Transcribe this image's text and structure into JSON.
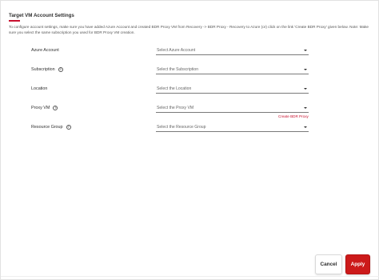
{
  "dialog": {
    "title": "Target VM Account Settings",
    "description": "To configure account settings, make sure you have added Azure Account and created BDR Proxy VM from Recovery -> BDR Proxy - Recovery to Azure (or) click on the link 'Create BDR Proxy' given below. Note: Make sure you select the same subscription you used for BDR Proxy VM creation."
  },
  "fields": [
    {
      "label": "Azure Account",
      "help": false,
      "placeholder": "Select Azure Account"
    },
    {
      "label": "Subscription",
      "help": true,
      "placeholder": "Select the Subscription"
    },
    {
      "label": "Location",
      "help": false,
      "placeholder": "Select the Location"
    },
    {
      "label": "Proxy VM",
      "help": true,
      "placeholder": "Select the Proxy VM"
    },
    {
      "label": "Resource Group",
      "help": true,
      "placeholder": "Select the Resource Group"
    }
  ],
  "help_glyph": "?",
  "create_link": "Create BDR Proxy",
  "footer": {
    "cancel_label": "Cancel",
    "apply_label": "Apply"
  },
  "colors": {
    "accent": "#cc1a1a",
    "link": "#c8102e"
  }
}
